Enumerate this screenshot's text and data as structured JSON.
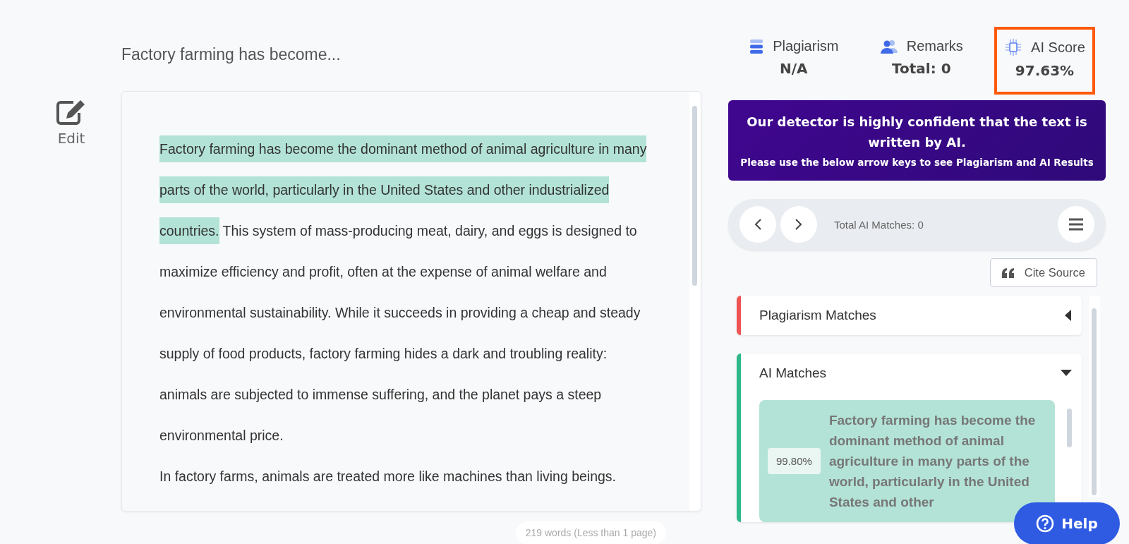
{
  "document": {
    "title": "Factory farming has become...",
    "edit_label": "Edit",
    "paragraphs": [
      [
        {
          "text": "Factory farming has become the dominant method of animal agriculture in many parts of the world, particularly in the United States and other industrialized countries.",
          "ai": true
        },
        {
          "text": " This system of mass-producing meat, dairy, and eggs is designed to maximize efficiency and profit, often at the expense of animal welfare and environmental sustainability. While it succeeds in providing a cheap and steady supply of food products, factory farming hides a dark and troubling reality: animals are subjected to immense suffering, and the planet pays a steep environmental price.",
          "ai": false
        }
      ],
      [
        {
          "text": "In factory farms, animals are treated more like machines than living beings.",
          "ai": false
        }
      ]
    ],
    "word_count": "219 words (Less than 1 page)"
  },
  "stats": [
    {
      "kind": "plagiarism",
      "label": "Plagiarism",
      "value": "N/A",
      "selected": false
    },
    {
      "kind": "remarks",
      "label": "Remarks",
      "value": "Total: 0",
      "selected": false
    },
    {
      "kind": "ai",
      "label": "AI Score",
      "value": "97.63%",
      "selected": true
    }
  ],
  "banner": {
    "headline": "Our detector is highly confident that the text is written by AI.",
    "note": "Please use the below arrow keys to see Plagiarism and AI Results"
  },
  "navigator": {
    "total": "Total AI Matches: 0"
  },
  "cite_button": "Cite Source",
  "sections": [
    {
      "title": "Plagiarism Matches",
      "color": "#f05454",
      "expanded": false
    },
    {
      "title": "AI Matches",
      "color": "#2fb98a",
      "expanded": true,
      "matches": [
        {
          "score": "99.80%",
          "text": "Factory farming has become the dominant method of animal agriculture in many parts of the world, particularly in the United States and other"
        }
      ]
    }
  ],
  "help_button": "Help"
}
